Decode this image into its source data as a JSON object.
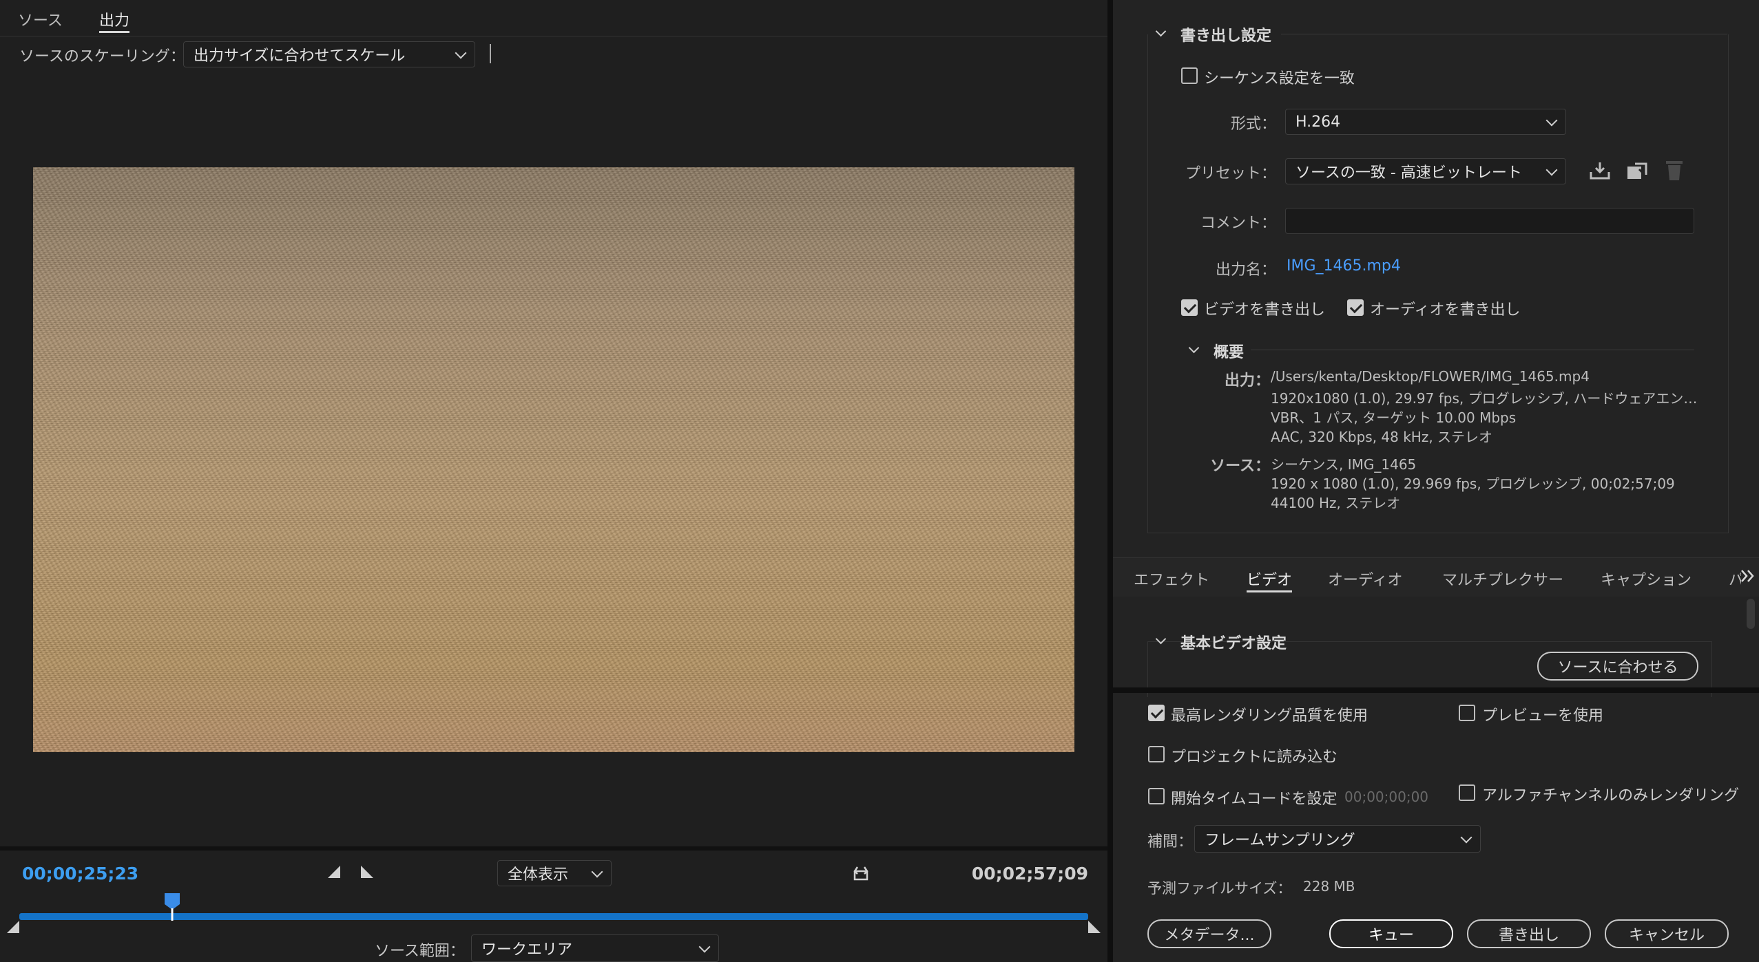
{
  "left": {
    "tabs": [
      {
        "label": "ソース",
        "active": false
      },
      {
        "label": "出力",
        "active": true
      }
    ],
    "scaling_label": "ソースのスケーリング：",
    "scaling_value": "出力サイズに合わせてスケール",
    "timecode_current": "00;00;25;23",
    "timecode_total": "00;02;57;09",
    "zoom_value": "全体表示",
    "playhead_fraction": 0.143,
    "source_range_label": "ソース範囲：",
    "source_range_value": "ワークエリア"
  },
  "export_settings": {
    "title": "書き出し設定",
    "match_sequence": "シーケンス設定を一致",
    "format_label": "形式：",
    "format_value": "H.264",
    "preset_label": "プリセット：",
    "preset_value": "ソースの一致 - 高速ビットレート",
    "comment_label": "コメント：",
    "output_name_label": "出力名：",
    "output_name_value": "IMG_1465.mp4",
    "export_video": "ビデオを書き出し",
    "export_audio": "オーディオを書き出し",
    "summary_title": "概要",
    "output_label": "出力：",
    "output_lines": [
      "/Users/kenta/Desktop/FLOWER/IMG_1465.mp4",
      "1920x1080 (1.0), 29.97 fps, プログレッシブ, ハードウェアエン…",
      "VBR、1 パス, ターゲット 10.00 Mbps",
      "AAC, 320 Kbps, 48 kHz, ステレオ"
    ],
    "source_label": "ソース：",
    "source_lines": [
      "シーケンス, IMG_1465",
      "1920 x 1080 (1.0), 29.969 fps, プログレッシブ, 00;02;57;09",
      "44100 Hz, ステレオ"
    ]
  },
  "tabs": [
    {
      "label": "エフェクト",
      "active": false
    },
    {
      "label": "ビデオ",
      "active": true
    },
    {
      "label": "オーディオ",
      "active": false
    },
    {
      "label": "マルチプレクサー",
      "active": false
    },
    {
      "label": "キャプション",
      "active": false
    },
    {
      "label": "パ",
      "active": false
    }
  ],
  "video_basic": {
    "title": "基本ビデオ設定",
    "match_source_button": "ソースに合わせる"
  },
  "bottom": {
    "max_render_quality": "最高レンダリング品質を使用",
    "use_preview": "プレビューを使用",
    "import_project": "プロジェクトに読み込む",
    "set_start_timecode": "開始タイムコードを設定",
    "start_timecode_value": "00;00;00;00",
    "alpha_only": "アルファチャンネルのみレンダリング",
    "interp_label": "補間：",
    "interp_value": "フレームサンプリング",
    "filesize_label": "予測ファイルサイズ：",
    "filesize_value": "228 MB",
    "buttons": {
      "metadata": "メタデータ...",
      "queue": "キュー",
      "export": "書き出し",
      "cancel": "キャンセル"
    }
  },
  "colors": {
    "accent_blue": "#2d8ceb",
    "link_blue": "#4a9eff",
    "timeline_blue": "#1473c8"
  },
  "icons": [
    "save-preset-icon",
    "import-preset-icon",
    "delete-preset-icon",
    "in-point-icon",
    "out-point-icon",
    "fit-icon",
    "playhead-icon",
    "chevron-double-right-icon"
  ]
}
